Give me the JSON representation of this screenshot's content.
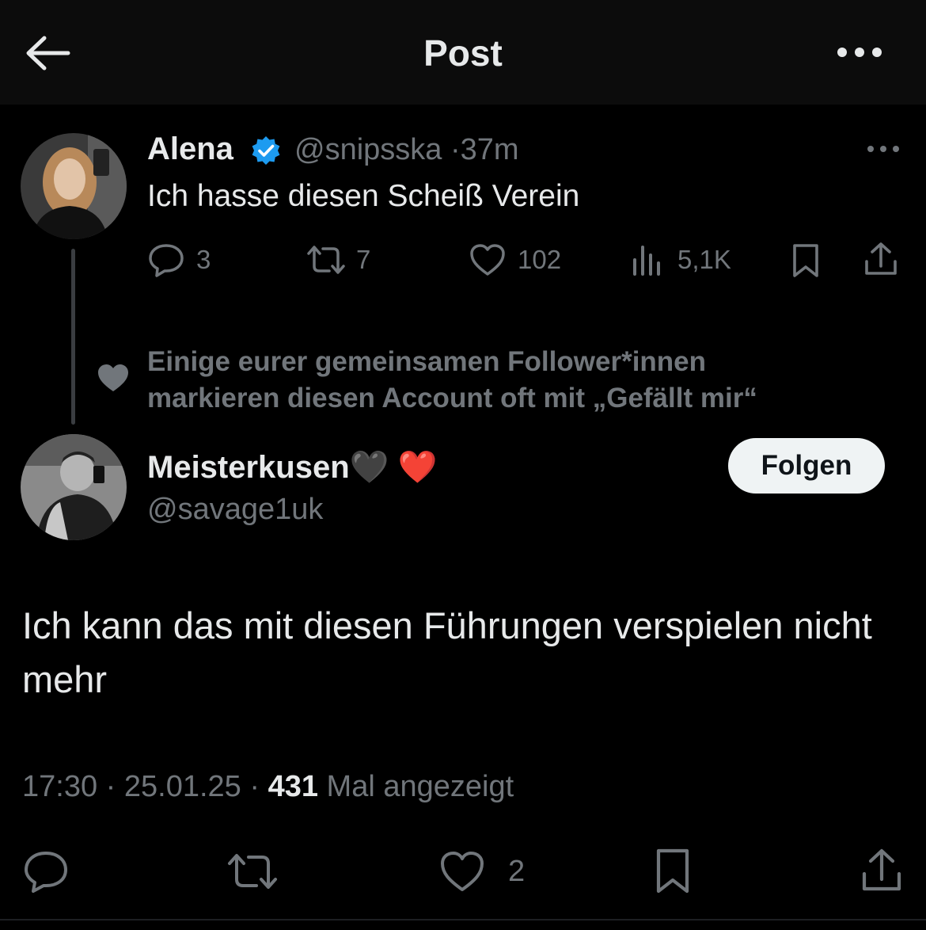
{
  "header": {
    "title": "Post",
    "back_icon": "arrow-left-icon",
    "more_icon": "more-horizontal-icon"
  },
  "parent_post": {
    "name": "Alena",
    "verified": true,
    "handle": "@snipsska",
    "separator": "·",
    "time": "37m",
    "text": "Ich hasse diesen Scheiß Verein",
    "actions": {
      "replies": "3",
      "reposts": "7",
      "likes": "102",
      "views": "5,1K"
    }
  },
  "social_context": {
    "line1": "Einige eurer gemeinsamen Follower*innen",
    "line2": "markieren diesen Account oft mit „Gefällt mir“"
  },
  "main_post": {
    "name": "Meisterkusen",
    "name_emojis": "🖤 ❤️",
    "handle": "@savage1uk",
    "follow_label": "Folgen",
    "text": "Ich kann das mit diesen Führungen verspielen nicht mehr",
    "time": "17:30",
    "date": "25.01.25",
    "separator": "·",
    "views_count": "431",
    "views_label": "Mal angezeigt",
    "actions": {
      "likes": "2"
    }
  },
  "colors": {
    "background": "#000000",
    "text": "#e7e9ea",
    "muted": "#71767b",
    "verified": "#1d9bf0",
    "heart_red": "#e0245e"
  }
}
